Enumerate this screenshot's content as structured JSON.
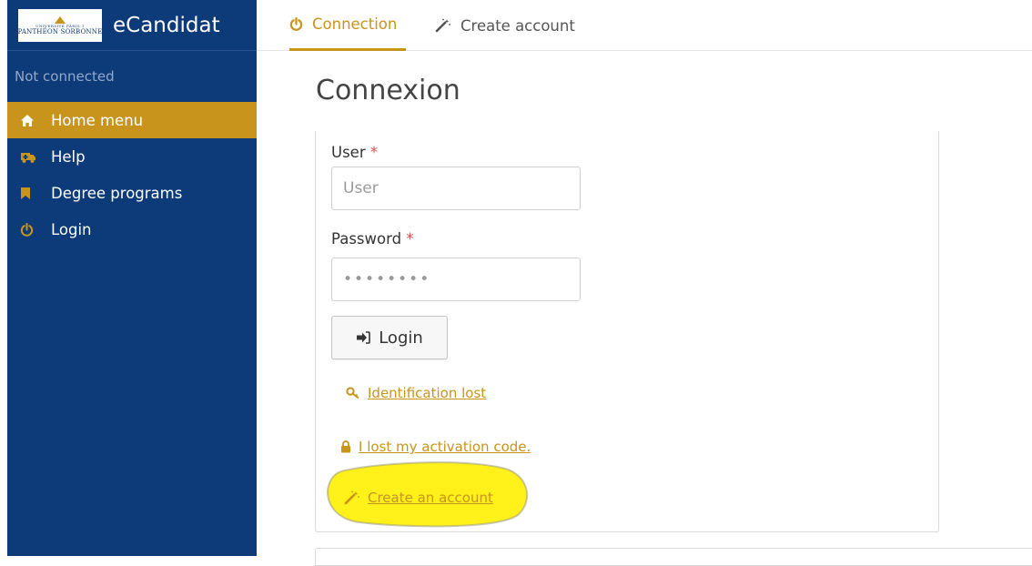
{
  "app": {
    "logo_line1": "UNIVERSITÉ PARIS 1",
    "logo_line2": "PANTHÉON SORBONNE",
    "title": "eCandidat"
  },
  "sidebar": {
    "status": "Not connected",
    "items": [
      {
        "label": "Home menu",
        "icon": "home-icon",
        "active": true
      },
      {
        "label": "Help",
        "icon": "ambulance-icon",
        "active": false
      },
      {
        "label": "Degree programs",
        "icon": "bookmark-icon",
        "active": false
      },
      {
        "label": "Login",
        "icon": "power-icon",
        "active": false
      }
    ]
  },
  "tabs": [
    {
      "label": "Connection",
      "icon": "power-icon",
      "active": true
    },
    {
      "label": "Create account",
      "icon": "magic-wand-icon",
      "active": false
    }
  ],
  "main": {
    "title": "Connexion",
    "form": {
      "user_label": "User",
      "user_placeholder": "User",
      "user_value": "",
      "password_label": "Password",
      "password_value": "********",
      "required_mark": "*",
      "login_button": "Login"
    },
    "links": [
      {
        "label": "Identification lost",
        "icon": "key-icon"
      },
      {
        "label": "I lost my activation code.",
        "icon": "lock-icon"
      },
      {
        "label": "Create an account",
        "icon": "magic-wand-icon"
      }
    ]
  },
  "colors": {
    "sidebar_bg": "#0d3b7a",
    "accent": "#c8941c",
    "highlight": "#ffef00",
    "required": "#d9534f"
  }
}
